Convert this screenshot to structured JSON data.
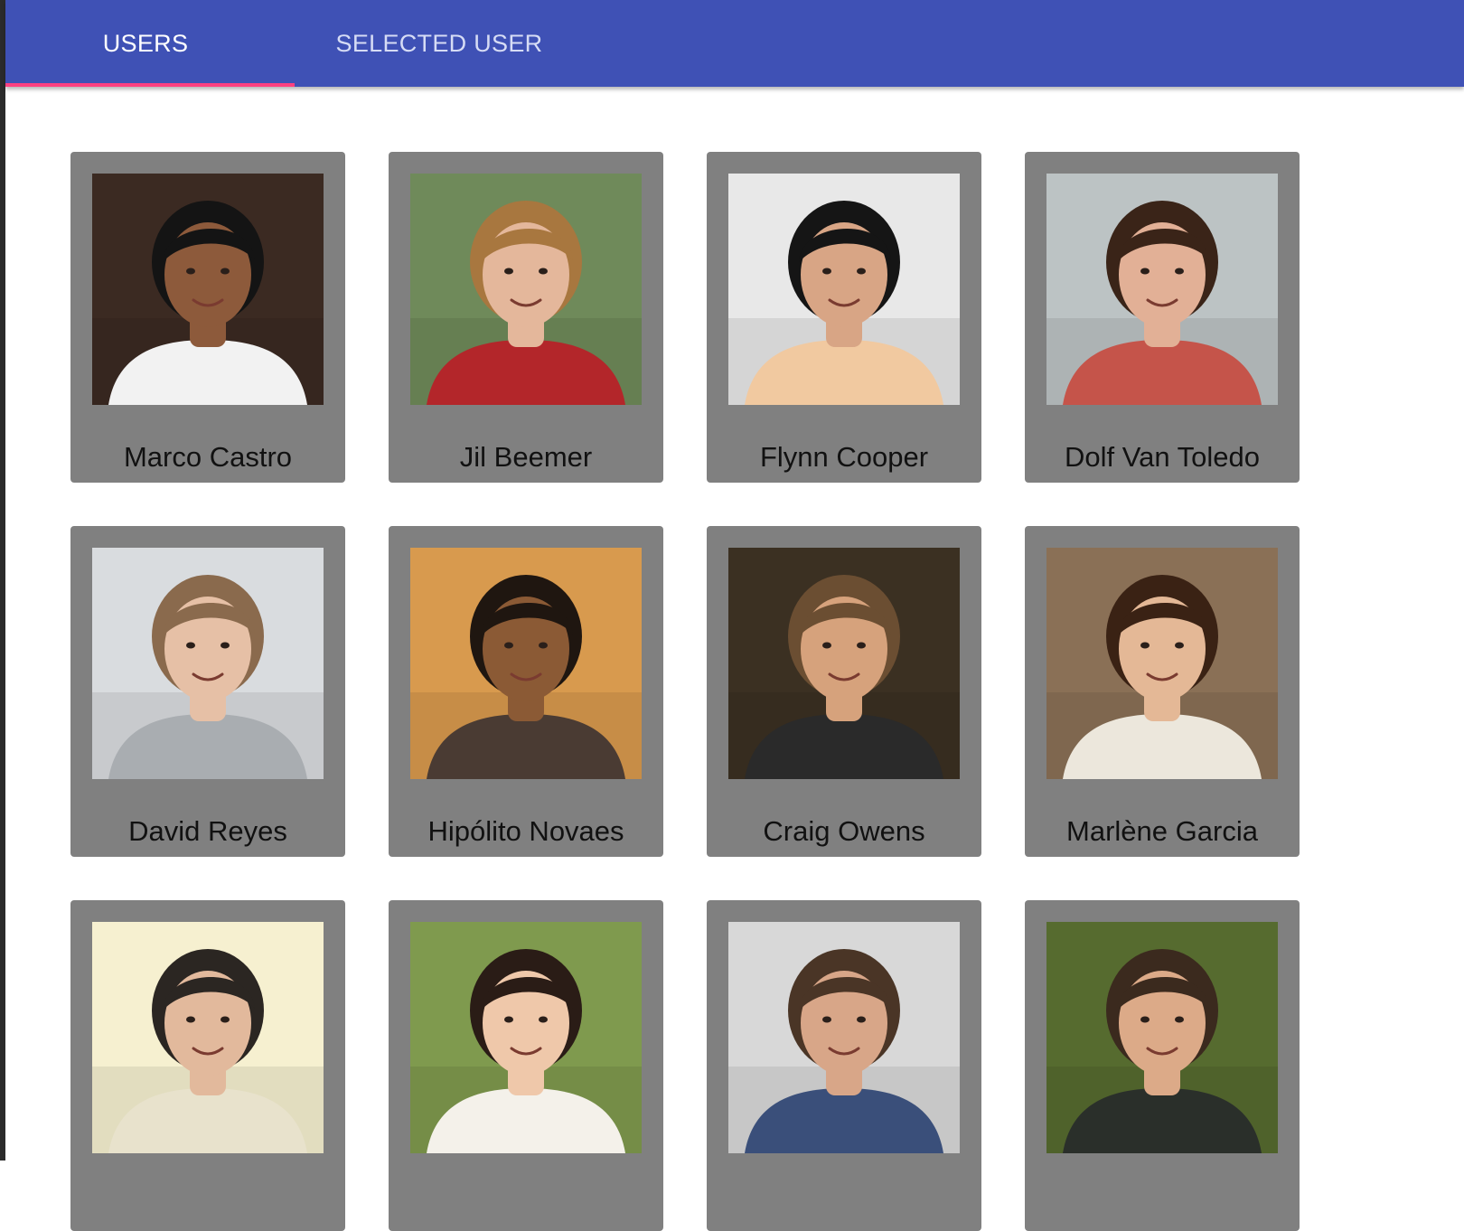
{
  "tabs": {
    "users_label": "USERS",
    "selected_user_label": "SELECTED USER",
    "active": "users"
  },
  "colors": {
    "appbar": "#3f51b5",
    "indicator": "#ff4081",
    "card": "#808080"
  },
  "users": [
    {
      "name": "Marco Castro",
      "photo": {
        "bg": "#3b2a22",
        "skin": "#8d5a3b",
        "hair": "#141414",
        "shirt": "#f2f2f2"
      }
    },
    {
      "name": "Jil Beemer",
      "photo": {
        "bg": "#6f8a5a",
        "skin": "#e4b79b",
        "hair": "#a8773f",
        "shirt": "#b3262a"
      }
    },
    {
      "name": "Flynn Cooper",
      "photo": {
        "bg": "#e8e8e8",
        "skin": "#d8a585",
        "hair": "#151515",
        "shirt": "#f1c9a0"
      }
    },
    {
      "name": "Dolf Van Toledo",
      "photo": {
        "bg": "#bcc3c4",
        "skin": "#e2b096",
        "hair": "#3a2418",
        "shirt": "#c5544a"
      }
    },
    {
      "name": "David Reyes",
      "photo": {
        "bg": "#d9dcdf",
        "skin": "#e6c0a6",
        "hair": "#8a6a4d",
        "shirt": "#a9adb1"
      }
    },
    {
      "name": "Hipólito Novaes",
      "photo": {
        "bg": "#d89a4e",
        "skin": "#8b5a35",
        "hair": "#1f1610",
        "shirt": "#4a3b33"
      }
    },
    {
      "name": "Craig Owens",
      "photo": {
        "bg": "#3b3022",
        "skin": "#d6a27c",
        "hair": "#6b4e32",
        "shirt": "#2a2a2a"
      }
    },
    {
      "name": "Marlène Garcia",
      "photo": {
        "bg": "#8a7056",
        "skin": "#e4b896",
        "hair": "#3a2214",
        "shirt": "#ece7dc"
      }
    },
    {
      "name": "",
      "photo": {
        "bg": "#f6f0d0",
        "skin": "#e2b99c",
        "hair": "#2b2622",
        "shirt": "#e8e2cc"
      }
    },
    {
      "name": "",
      "photo": {
        "bg": "#7f9a4e",
        "skin": "#efc8aa",
        "hair": "#2a1c16",
        "shirt": "#f4f1ea"
      }
    },
    {
      "name": "",
      "photo": {
        "bg": "#d8d8d8",
        "skin": "#d8a688",
        "hair": "#4a3526",
        "shirt": "#3a4f7a"
      }
    },
    {
      "name": "",
      "photo": {
        "bg": "#566b2f",
        "skin": "#dcaa88",
        "hair": "#3b2a1e",
        "shirt": "#2a2f2a"
      }
    }
  ]
}
